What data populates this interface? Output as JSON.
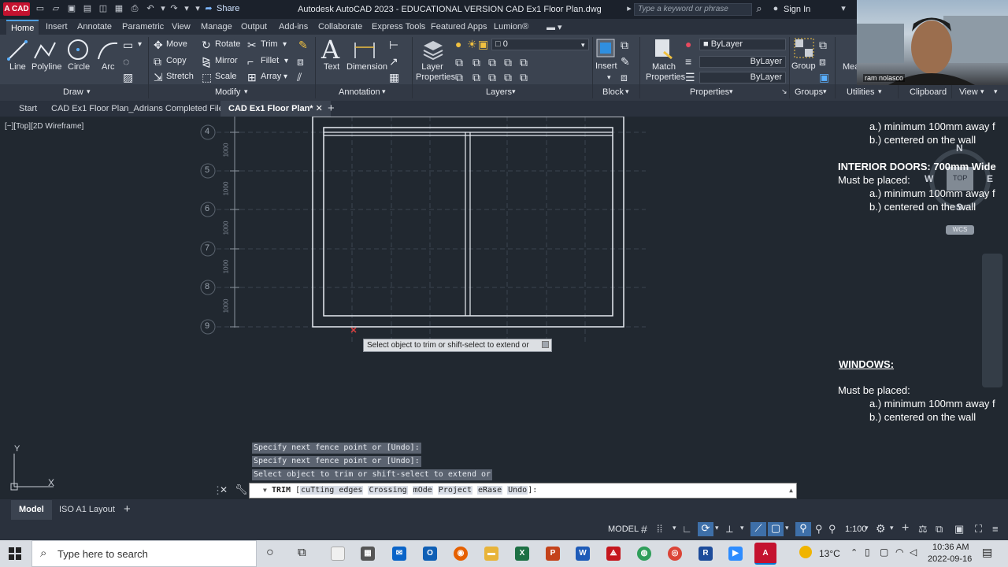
{
  "titlebar": {
    "app_icon": "A CAD",
    "share_label": "Share",
    "app_title": "Autodesk AutoCAD 2023 - EDUCATIONAL VERSION    CAD Ex1 Floor Plan.dwg",
    "search_placeholder": "Type a keyword or phrase",
    "signin_label": "Sign In"
  },
  "ribbon_tabs": [
    "Home",
    "Insert",
    "Annotate",
    "Parametric",
    "View",
    "Manage",
    "Output",
    "Add-ins",
    "Collaborate",
    "Express Tools",
    "Featured Apps",
    "Lumion®"
  ],
  "ribbon": {
    "draw": {
      "line": "Line",
      "polyline": "Polyline",
      "circle": "Circle",
      "arc": "Arc",
      "panel": "Draw"
    },
    "modify": {
      "move": "Move",
      "rotate": "Rotate",
      "trim": "Trim",
      "copy": "Copy",
      "mirror": "Mirror",
      "fillet": "Fillet",
      "stretch": "Stretch",
      "scale": "Scale",
      "array": "Array",
      "panel": "Modify"
    },
    "annotation": {
      "text": "Text",
      "dimension": "Dimension",
      "panel": "Annotation"
    },
    "layers": {
      "layer_properties": "Layer Properties",
      "current_layer": "0",
      "panel": "Layers"
    },
    "block": {
      "insert": "Insert",
      "panel": "Block"
    },
    "properties": {
      "match": "Match Properties",
      "color": "ByLayer",
      "linetype": "ByLayer",
      "lineweight": "ByLayer",
      "panel": "Properties"
    },
    "groups": {
      "group": "Group",
      "panel": "Groups"
    },
    "utilities": {
      "measure": "Mea",
      "panel": "Utilities"
    },
    "clipboard": {
      "panel": "Clipboard"
    },
    "view": {
      "panel": "View"
    }
  },
  "file_tabs": [
    "Start",
    "CAD Ex1 Floor Plan_Adrians Completed File*",
    "CAD Ex1 Floor Plan*"
  ],
  "viewport": {
    "label": "[−][Top][2D Wireframe]",
    "grid_labels": [
      "4",
      "5",
      "6",
      "7",
      "8",
      "9"
    ],
    "dimension_labels": [
      "1000",
      "1000",
      "1000",
      "1000",
      "1000"
    ]
  },
  "notes": {
    "line1": "a.) minimum 100mm away f",
    "line2": "b.) centered on the wall",
    "interior_title": "INTERIOR DOORS: 700mm Wide",
    "interior_placed": "Must be placed:",
    "interior_a": "a.) minimum 100mm away f",
    "interior_b": "b.) centered on the wall",
    "windows_title": "WINDOWS:",
    "windows_placed": "Must be placed:",
    "windows_a": "a.) minimum 100mm away f",
    "windows_b": "b.) centered on the wall"
  },
  "viewcube": {
    "n": "N",
    "w": "W",
    "e": "E",
    "s": "S",
    "top": "TOP",
    "wcs": "WCS"
  },
  "tooltip": "Select object to trim or shift-select to extend or",
  "command_history": [
    "Specify next fence point or [Undo]:",
    "Specify next fence point or [Undo]:",
    "Select object to trim or shift-select to extend or"
  ],
  "command_line": {
    "command": "TRIM",
    "opening": "[",
    "options": [
      "cuTting edges",
      "Crossing",
      "mOde",
      "Project",
      "eRase",
      "Undo"
    ],
    "closing": "]:"
  },
  "ucs": {
    "x": "X",
    "y": "Y"
  },
  "layout_tabs": [
    "Model",
    "ISO A1 Layout"
  ],
  "status": {
    "model": "MODEL",
    "scale": "1:100"
  },
  "taskbar": {
    "search": "Type here to search",
    "weather": "13°C",
    "time": "10:36 AM",
    "date": "2022-09-16"
  },
  "webcam": {
    "name": "ram nolasco"
  }
}
